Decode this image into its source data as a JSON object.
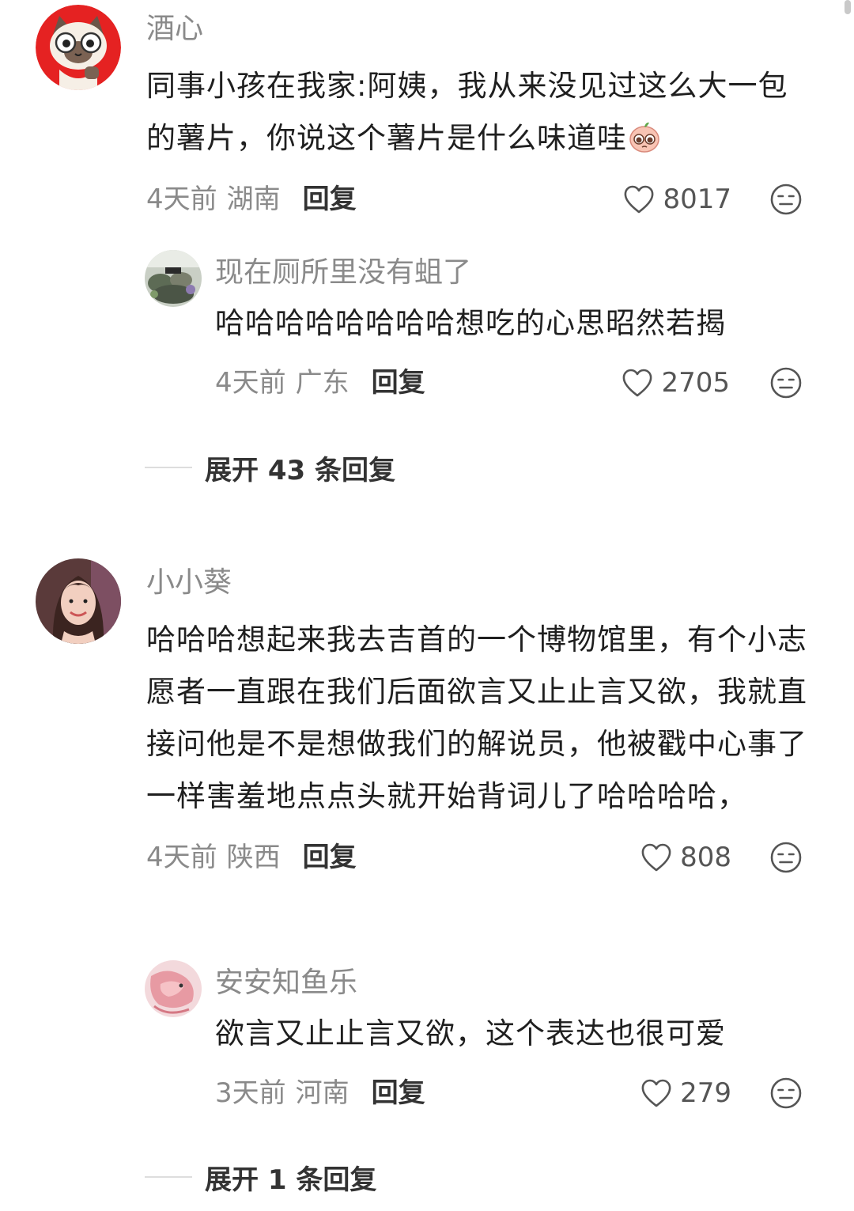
{
  "comments": [
    {
      "username": "酒心",
      "avatar": "siamese-cat-cartoon-avatar",
      "text": "同事小孩在我家:阿姨，我从来没见过这么大一包的薯片，你说这个薯片是什么味道哇",
      "text_emoji": "pleading-face-emoji",
      "time": "4天前",
      "location": "湖南",
      "reply_label": "回复",
      "likes": "8017",
      "replies": [
        {
          "username": "现在厕所里没有蛆了",
          "avatar": "outdoor-photo-avatar",
          "text": "哈哈哈哈哈哈哈哈想吃的心思昭然若揭",
          "time": "4天前",
          "location": "广东",
          "reply_label": "回复",
          "likes": "2705"
        }
      ],
      "expand_label": "展开 43 条回复"
    },
    {
      "username": "小小葵",
      "avatar": "woman-portrait-avatar",
      "text": "哈哈哈想起来我去吉首的一个博物馆里，有个小志愿者一直跟在我们后面欲言又止止言又欲，我就直接问他是不是想做我们的解说员，他被戳中心事了一样害羞地点点头就开始背词儿了哈哈哈哈，",
      "time": "4天前",
      "location": "陕西",
      "reply_label": "回复",
      "likes": "808",
      "replies": [
        {
          "username": "安安知鱼乐",
          "avatar": "betta-fish-avatar",
          "text": "欲言又止止言又欲，这个表达也很可爱",
          "time": "3天前",
          "location": "河南",
          "reply_label": "回复",
          "likes": "279"
        }
      ],
      "expand_label": "展开 1 条回复"
    }
  ],
  "colors": {
    "username": "#8a8a8a",
    "text": "#1f1f1f",
    "meta": "#8a8a8a",
    "action": "#333333",
    "icon": "#555555",
    "cat_avatar_bg": "#e52222"
  }
}
